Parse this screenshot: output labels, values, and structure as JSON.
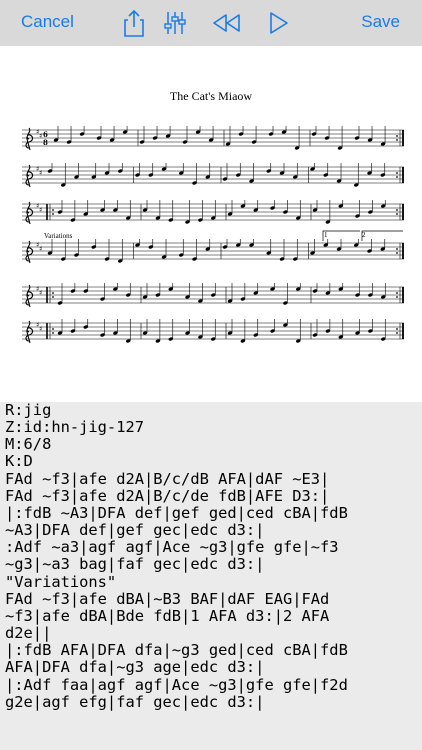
{
  "toolbar": {
    "cancel_label": "Cancel",
    "save_label": "Save",
    "accent": "#1a7be8",
    "icons": [
      "share-icon",
      "sliders-icon",
      "rewind-icon",
      "play-icon"
    ]
  },
  "score": {
    "title": "The Cat's Miaow",
    "variations_label": "Variations",
    "ending_1": "1",
    "ending_2": "2"
  },
  "abc_lines": [
    "R:jig",
    "Z:id:hn-jig-127",
    "M:6/8",
    "K:D",
    "FAd ~f3|afe d2A|B/c/dB AFA|dAF ~E3|",
    "FAd ~f3|afe d2A|B/c/de fdB|AFE D3:|",
    "|:fdB ~A3|DFA def|gef ged|ced cBA|fdB",
    "~A3|DFA def|gef gec|edc d3:|",
    ":Adf ~a3|agf agf|Ace ~g3|gfe gfe|~f3",
    "~g3|~a3 bag|faf gec|edc d3:|",
    "\"Variations\"",
    "FAd ~f3|afe dBA|~B3 BAF|dAF EAG|FAd",
    "~f3|afe dBA|Bde fdB|1 AFA d3:|2 AFA",
    "d2e||",
    "|:fdB AFA|DFA dfa|~g3 ged|ced cBA|fdB",
    "AFA|DFA dfa|~g3 age|edc d3:|",
    "|:Adf faa|agf agf|Ace ~g3|gfe gfe|f2d",
    "g2e|agf efg|faf gec|edc d3:|"
  ]
}
